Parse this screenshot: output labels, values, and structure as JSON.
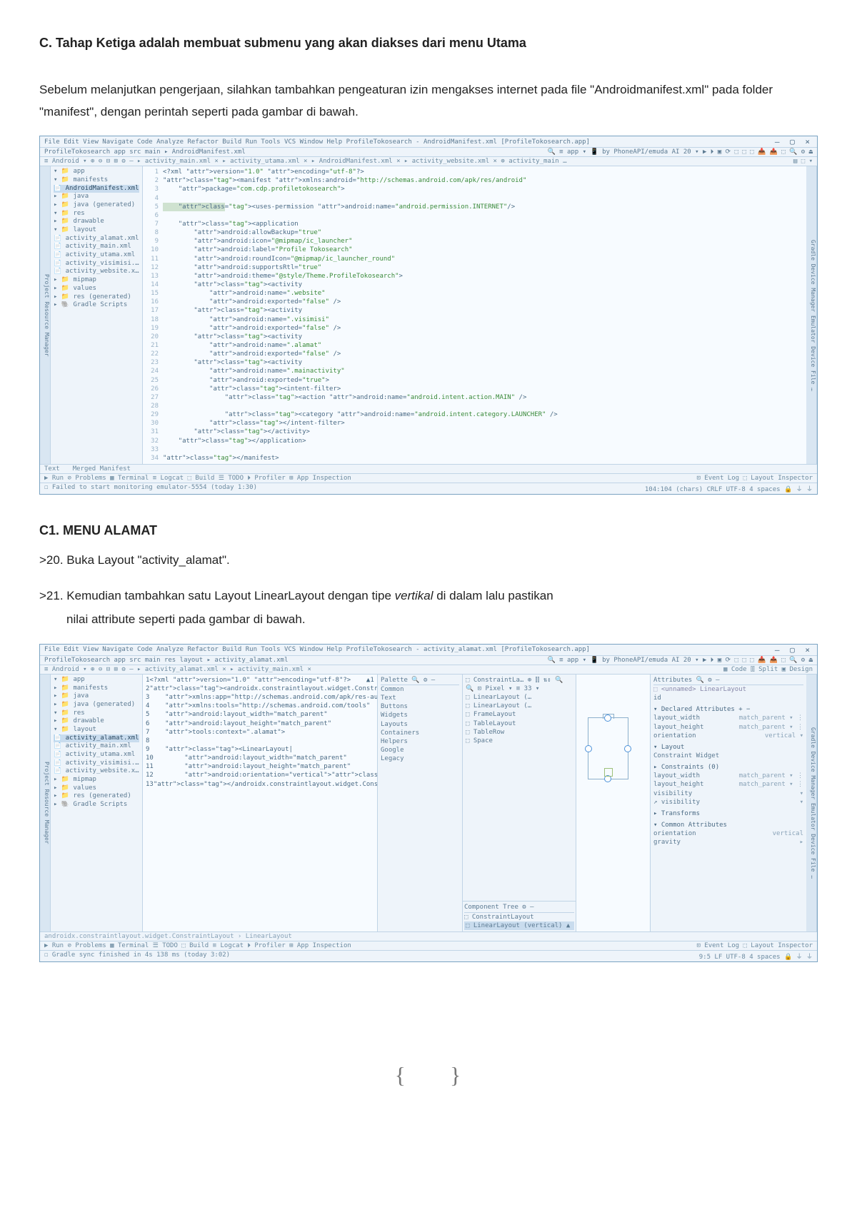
{
  "doc": {
    "headingC": "C.  Tahap Ketiga adalah membuat submenu yang akan diakses dari menu Utama",
    "para1": "Sebelum melanjutkan pengerjaan, silahkan tambahkan pengeaturan izin mengakses internet pada file \"Androidmanifest.xml\" pada folder \"manifest\", dengan perintah seperti pada gambar di bawah.",
    "headingC1": "C1.  MENU ALAMAT",
    "step20": ">20. Buka Layout \"activity_alamat\".",
    "step21a": ">21. Kemudian tambahkan satu Layout LinearLayout dengan tipe ",
    "step21b": "vertikal",
    "step21c": " di dalam lalu pastikan",
    "step21d": "nilai attribute seperti pada gambar di bawah."
  },
  "ide1": {
    "titlebar_left": "File  Edit  View  Navigate  Code  Analyze  Refactor  Build  Run  Tools  VCS  Window  Help     ProfileTokosearch - AndroidManifest.xml [ProfileTokosearch.app]",
    "titlebar_right": "–   ▢   ×",
    "tabs": "ProfileTokosearch  app  src  main  ▸ AndroidManifest.xml",
    "tabs_right": "🔍  ≡ app ▾   📱 by PhoneAPI/emuda AI 20 ▾   ▶  ⏵  ▣  ⟳  ⬚  ⬚  ⬚  📥  📤  ⬚   🔍  ⚙  ⏏",
    "toolbar_left": "≡ Android ▾   ⊕  ⊖  ⊟  ⊞   ⚙  –  ▸ activity_main.xml ×    ▸ activity_utama.xml ×    ▸ AndroidManifest.xml ×    ▸ activity_website.xml ×    ⊕ activity_main …",
    "project": [
      "▾ 📁 app",
      "  ▾ 📁 manifests",
      "      📄 AndroidManifest.xml",
      "  ▸ 📁 java",
      "  ▸ 📁 java (generated)",
      "  ▾ 📁 res",
      "    ▸ 📁 drawable",
      "    ▾ 📁 layout",
      "        📄 activity_alamat.xml",
      "        📄 activity_main.xml",
      "        📄 activity_utama.xml",
      "        📄 activity_visimisi.xml",
      "        📄 activity_website.xml",
      "    ▸ 📁 mipmap",
      "    ▸ 📁 values",
      "  ▸ 📁 res (generated)",
      "▸ 🐘 Gradle Scripts"
    ],
    "project_selected": 2,
    "code": [
      "<?xml version=\"1.0\" encoding=\"utf-8\"?>",
      "<manifest xmlns:android=\"http://schemas.android.com/apk/res/android\"",
      "    package=\"com.cdp.profiletokosearch\">",
      "",
      "    <uses-permission android:name=\"android.permission.INTERNET\"/>",
      "",
      "    <application",
      "        android:allowBackup=\"true\"",
      "        android:icon=\"@mipmap/ic_launcher\"",
      "        android:label=\"Profile Tokosearch\"",
      "        android:roundIcon=\"@mipmap/ic_launcher_round\"",
      "        android:supportsRtl=\"true\"",
      "        android:theme=\"@style/Theme.ProfileTokosearch\">",
      "        <activity",
      "            android:name=\".website\"",
      "            android:exported=\"false\" />",
      "        <activity",
      "            android:name=\".visimisi\"",
      "            android:exported=\"false\" />",
      "        <activity",
      "            android:name=\".alamat\"",
      "            android:exported=\"false\" />",
      "        <activity",
      "            android:name=\".mainactivity\"",
      "            android:exported=\"true\">",
      "            <intent-filter>",
      "                <action android:name=\"android.intent.action.MAIN\" />",
      "",
      "                <category android:name=\"android.intent.category.LAUNCHER\" />",
      "            </intent-filter>",
      "        </activity>",
      "    </application>",
      "",
      "</manifest>"
    ],
    "highlight_line": 4,
    "code_tabs_left": "Text",
    "code_tabs_right": "Merged Manifest",
    "bottom_left": "▶ Run   ⊘ Problems   ▦ Terminal   ≡ Logcat   ⬚ Build   ☰ TODO   ⏵ Profiler   ⊞ App Inspection",
    "bottom_right": "⊡ Event Log   ⬚ Layout Inspector",
    "status_left": "☐  Failed to start monitoring emulator-5554 (today 1:30)",
    "status_right": "104:104 (chars)  CRLF  UTF-8   4 spaces  🔒  ⏚  ⏚"
  },
  "ide2": {
    "titlebar_left": "File  Edit  View  Navigate  Code  Analyze  Refactor  Build  Run  Tools  VCS  Window  Help     ProfileTokosearch - activity_alamat.xml [ProfileTokosearch.app]",
    "titlebar_right": "–   ▢   ×",
    "tabs": "ProfileTokosearch  app  src  main  res  layout  ▸ activity_alamat.xml",
    "tabs_right": "🔍  ≡ app ▾   📱 by PhoneAPI/emuda AI 20 ▾   ▶  ⏵  ▣  ⟳  ⬚  ⬚  ⬚  📥  📤  ⬚   🔍  ⚙  ⏏",
    "toolbar_left": "≡ Android ▾   ⊕  ⊖  ⊟  ⊞   ⚙  –  ▸ activity_alamat.xml ×    ▸ activity_main.xml ×",
    "toolbar_right": "▦ Code  ⫿⫿ Split  ▣ Design",
    "project": [
      "▾ 📁 app",
      "  ▸ 📁 manifests",
      "  ▸ 📁 java",
      "  ▸ 📁 java (generated)",
      "  ▾ 📁 res",
      "    ▸ 📁 drawable",
      "    ▾ 📁 layout",
      "        📄 activity_alamat.xml",
      "        📄 activity_main.xml",
      "        📄 activity_utama.xml",
      "        📄 activity_visimisi.xml",
      "        📄 activity_website.xml",
      "    ▸ 📁 mipmap",
      "    ▸ 📁 values",
      "  ▸ 📁 res (generated)",
      "▸ 🐘 Gradle Scripts"
    ],
    "project_selected": 7,
    "code": [
      "<?xml version=\"1.0\" encoding=\"utf-8\"?>    ▲1 ⚠1 ▬ ▬ ╳",
      "<androidx.constraintlayout.widget.ConstraintLayout xmlns",
      "    xmlns:app=\"http://schemas.android.com/apk/res-auto\"",
      "    xmlns:tools=\"http://schemas.android.com/tools\"",
      "    android:layout_width=\"match_parent\"",
      "    android:layout_height=\"match_parent\"",
      "    tools:context=\".alamat\">",
      "",
      "    <LinearLayout|",
      "        android:layout_width=\"match_parent\"",
      "        android:layout_height=\"match_parent\"",
      "        android:orientation=\"vertical\"></LinearLayout>",
      "</androidx.constraintlayout.widget.ConstraintLayout>"
    ],
    "palette_header": "Palette        🔍  ⚙  –",
    "palette": [
      "Common",
      "Text",
      "Buttons",
      "Widgets",
      "Layouts",
      "Containers",
      "Helpers",
      "Google",
      "Legacy"
    ],
    "palette_items": [
      "⬚ ConstraintLa…     ⊕  ⫿⫿  ⇅↕  🔍 🔍  ⊡ Pixel ▾  ≡ 33 ▾",
      "⬚ LinearLayout (…",
      "⬚ LinearLayout (…",
      "⬚ FrameLayout",
      "⬚ TableLayout",
      "⬚ TableRow",
      "⬚ Space"
    ],
    "tree_header": "Component Tree        ⚙  –",
    "tree": [
      "⬚ ConstraintLayout",
      "   ⬚ LinearLayout (vertical)   ▲"
    ],
    "attrs_header": "Attributes            🔍  ⚙  –",
    "attrs_sub": "⬚ <unnamed>           LinearLayout",
    "attrs_rows": [
      [
        "id",
        ""
      ],
      [
        "▾ Declared Attributes",
        "+  −"
      ],
      [
        "layout_width",
        "match_parent   ▾  ⋮"
      ],
      [
        "layout_height",
        "match_parent   ▾  ⋮"
      ],
      [
        "orientation",
        "vertical   ▾"
      ],
      [
        "▾ Layout",
        ""
      ],
      [
        "Constraint Widget",
        ""
      ],
      [
        "",
        ""
      ],
      [
        "▸ Constraints (0)",
        ""
      ],
      [
        "layout_width",
        "match_parent   ▾  ⋮"
      ],
      [
        "layout_height",
        "match_parent   ▾  ⋮"
      ],
      [
        "visibility",
        "▾"
      ],
      [
        "↗ visibility",
        "▾"
      ],
      [
        "▸ Transforms",
        ""
      ],
      [
        "▾ Common Attributes",
        ""
      ],
      [
        "orientation",
        "vertical"
      ],
      [
        "gravity",
        "▸"
      ]
    ],
    "editor_footer": "androidx.constraintlayout.widget.ConstraintLayout  ›  LinearLayout",
    "bottom_left": "▶ Run   ⊘ Problems   ▦ Terminal   ☰ TODO   ⬚ Build   ≡ Logcat   ⏵ Profiler   ⊞ App Inspection",
    "bottom_right": "⊡ Event Log   ⬚ Layout Inspector",
    "status_left": "☐  Gradle sync finished in 4s 138 ms (today 3:02)",
    "status_right": "9:5  LF  UTF-8   4 spaces  🔒  ⏚  ⏚"
  },
  "divider": {
    "left": "{",
    "right": "}"
  }
}
